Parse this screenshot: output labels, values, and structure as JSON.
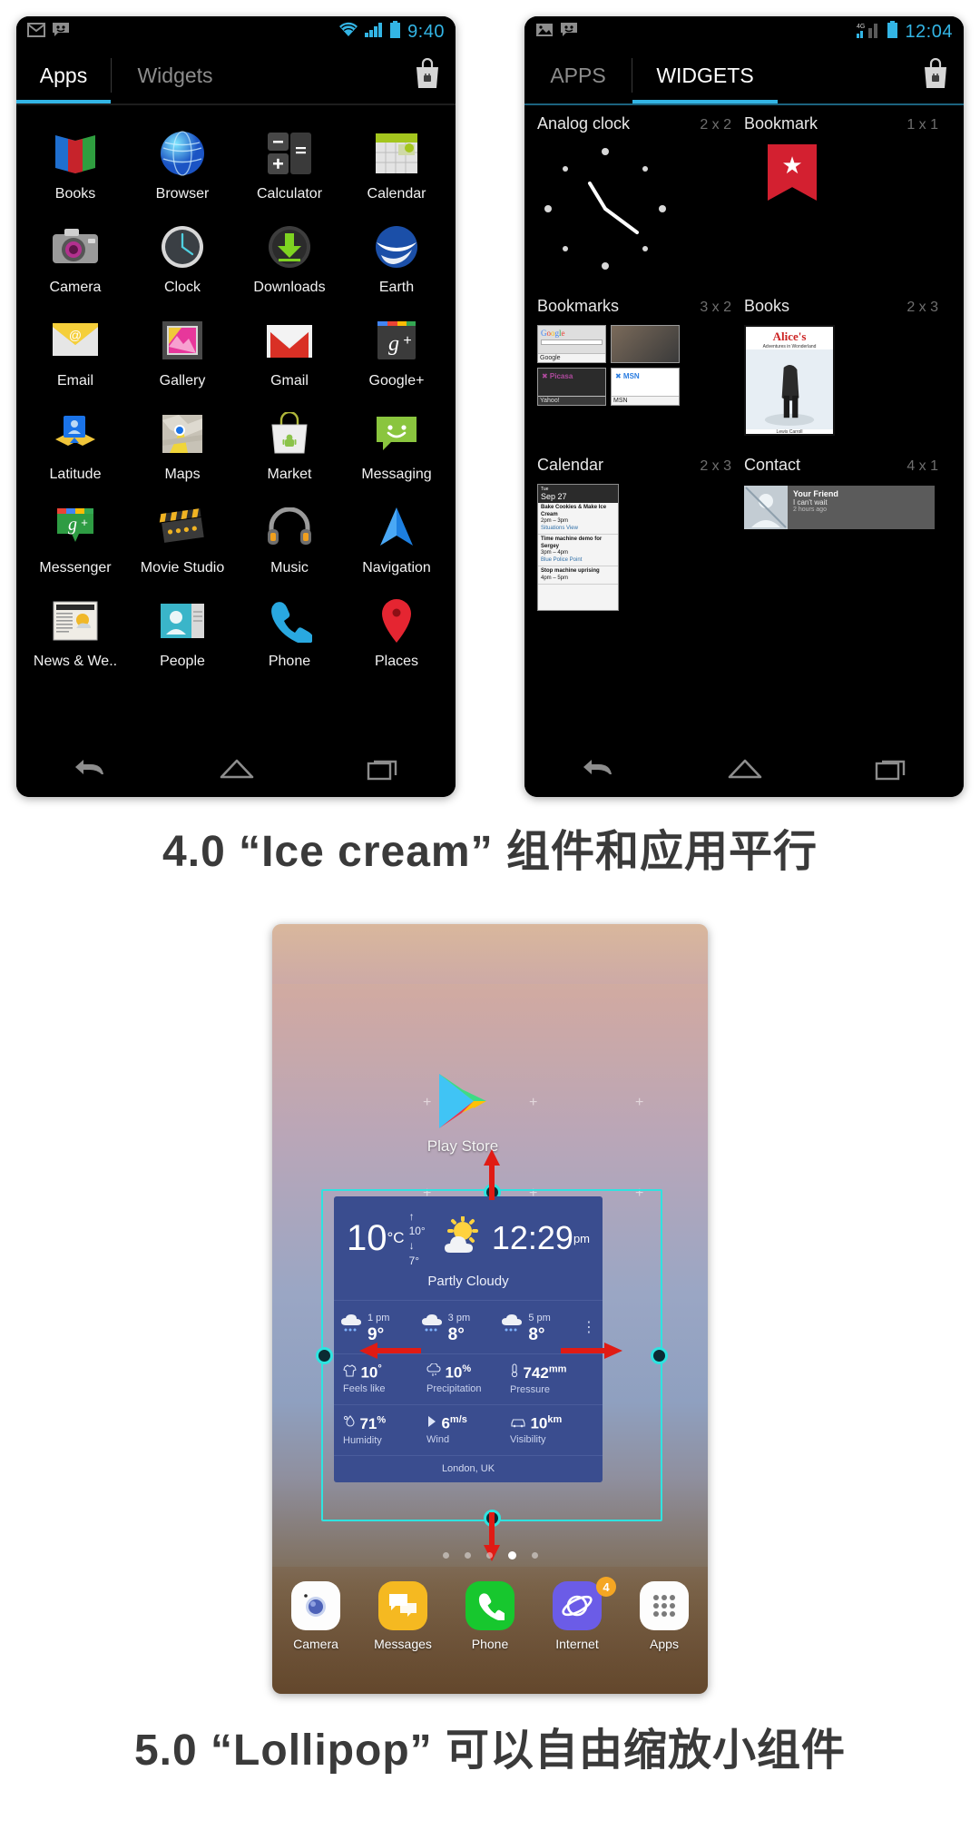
{
  "captions": {
    "ics": "4.0 “Ice cream” 组件和应用平行",
    "lollipop": "5.0 “Lollipop” 可以自由缩放小组件"
  },
  "ics_apps_phone": {
    "status": {
      "time": "9:40",
      "icons": [
        "gmail-icon",
        "messaging-icon",
        "wifi-icon",
        "signal-icon",
        "battery-icon"
      ]
    },
    "tabs": [
      {
        "label": "Apps",
        "selected": true
      },
      {
        "label": "Widgets",
        "selected": false
      }
    ],
    "market_button": "market-icon",
    "apps": [
      {
        "label": "Books",
        "icon": "books-icon"
      },
      {
        "label": "Browser",
        "icon": "browser-icon"
      },
      {
        "label": "Calculator",
        "icon": "calculator-icon"
      },
      {
        "label": "Calendar",
        "icon": "calendar-icon"
      },
      {
        "label": "Camera",
        "icon": "camera-icon"
      },
      {
        "label": "Clock",
        "icon": "clock-icon"
      },
      {
        "label": "Downloads",
        "icon": "downloads-icon"
      },
      {
        "label": "Earth",
        "icon": "earth-icon"
      },
      {
        "label": "Email",
        "icon": "email-icon"
      },
      {
        "label": "Gallery",
        "icon": "gallery-icon"
      },
      {
        "label": "Gmail",
        "icon": "gmail-icon"
      },
      {
        "label": "Google+",
        "icon": "google-plus-icon"
      },
      {
        "label": "Latitude",
        "icon": "latitude-icon"
      },
      {
        "label": "Maps",
        "icon": "maps-icon"
      },
      {
        "label": "Market",
        "icon": "market-icon"
      },
      {
        "label": "Messaging",
        "icon": "messaging-icon"
      },
      {
        "label": "Messenger",
        "icon": "messenger-icon"
      },
      {
        "label": "Movie Studio",
        "icon": "movie-studio-icon"
      },
      {
        "label": "Music",
        "icon": "music-icon"
      },
      {
        "label": "Navigation",
        "icon": "navigation-icon"
      },
      {
        "label": "News & We..",
        "icon": "news-weather-icon"
      },
      {
        "label": "People",
        "icon": "people-icon"
      },
      {
        "label": "Phone",
        "icon": "phone-icon"
      },
      {
        "label": "Places",
        "icon": "places-icon"
      }
    ],
    "navbar": [
      "back-icon",
      "home-icon",
      "recents-icon"
    ]
  },
  "ics_widgets_phone": {
    "status": {
      "time": "12:04",
      "network": "4G",
      "icons": [
        "gallery-icon",
        "messaging-icon",
        "signal-icon",
        "battery-icon"
      ]
    },
    "tabs": [
      {
        "label": "APPS",
        "selected": false
      },
      {
        "label": "WIDGETS",
        "selected": true
      }
    ],
    "market_button": "market-icon",
    "widgets": [
      {
        "name": "Analog clock",
        "size": "2 x 2"
      },
      {
        "name": "Bookmark",
        "size": "1 x 1"
      },
      {
        "name": "Bookmarks",
        "size": "3 x 2"
      },
      {
        "name": "Books",
        "size": "2 x 3"
      },
      {
        "name": "Calendar",
        "size": "2 x 3"
      },
      {
        "name": "Contact",
        "size": "4 x 1"
      }
    ],
    "bookmark_tiles": [
      "Google",
      "",
      "Yahoo!",
      "MSN"
    ],
    "bookmark_tile_labels": [
      "Google",
      "",
      "Yahoo!",
      "MSN"
    ],
    "book_widget": {
      "title": "Alice's",
      "subtitle": "Adventures in Wonderland",
      "author": "Lewis Carroll"
    },
    "calendar_widget": {
      "header_month": "Tue",
      "header_date": "Sep 27",
      "events": [
        {
          "title": "Bake Cookies & Make Ice Cream",
          "time": "2pm – 3pm",
          "place": "Situations View"
        },
        {
          "title": "Time machine demo for Sergey",
          "time": "3pm – 4pm",
          "place": "Blue Police Point"
        },
        {
          "title": "Stop machine uprising",
          "time": "4pm – 5pm",
          "place": ""
        }
      ]
    },
    "contact_widget": {
      "name": "Your Friend",
      "message": "I can't wait",
      "time": "2 hours ago"
    },
    "navbar": [
      "back-icon",
      "home-icon",
      "recents-icon"
    ]
  },
  "lollipop_phone": {
    "play_store_label": "Play Store",
    "weather_widget": {
      "temp": "10",
      "temp_unit": "°C",
      "high": "↑ 10°",
      "low": "↓ 7°",
      "condition": "Partly Cloudy",
      "clock": "12:29",
      "clock_suffix": "pm",
      "hourly": [
        {
          "time": "1 pm",
          "temp": "9°"
        },
        {
          "time": "3 pm",
          "temp": "8°"
        },
        {
          "time": "5 pm",
          "temp": "8°"
        }
      ],
      "stats": [
        {
          "value": "10",
          "unit": "°",
          "key": "Feels like",
          "icon": "shirt-icon"
        },
        {
          "value": "10",
          "unit": "%",
          "key": "Precipitation",
          "icon": "rain-cloud-icon"
        },
        {
          "value": "742",
          "unit": "mm",
          "key": "Pressure",
          "icon": "thermometer-icon"
        },
        {
          "value": "71",
          "unit": "%",
          "key": "Humidity",
          "icon": "droplet-icon"
        },
        {
          "value": "6",
          "unit": "m/s",
          "key": "Wind",
          "icon": "wind-arrow-icon"
        },
        {
          "value": "10",
          "unit": "km",
          "key": "Visibility",
          "icon": "car-icon"
        }
      ],
      "city": "London, UK"
    },
    "page_dots": 5,
    "active_dot": 3,
    "dock": [
      {
        "label": "Camera",
        "icon": "camera-icon",
        "badge": ""
      },
      {
        "label": "Messages",
        "icon": "messages-icon",
        "badge": ""
      },
      {
        "label": "Phone",
        "icon": "phone-icon",
        "badge": ""
      },
      {
        "label": "Internet",
        "icon": "internet-icon",
        "badge": "4"
      },
      {
        "label": "Apps",
        "icon": "apps-grid-icon",
        "badge": ""
      }
    ]
  },
  "colors": {
    "accent_cyan": "#33b5e5",
    "resize_outline": "#2fe3e0",
    "arrow_red": "#e01b14",
    "weather_bg": "#3a4d8f",
    "caption_text": "#3a3a3a"
  }
}
